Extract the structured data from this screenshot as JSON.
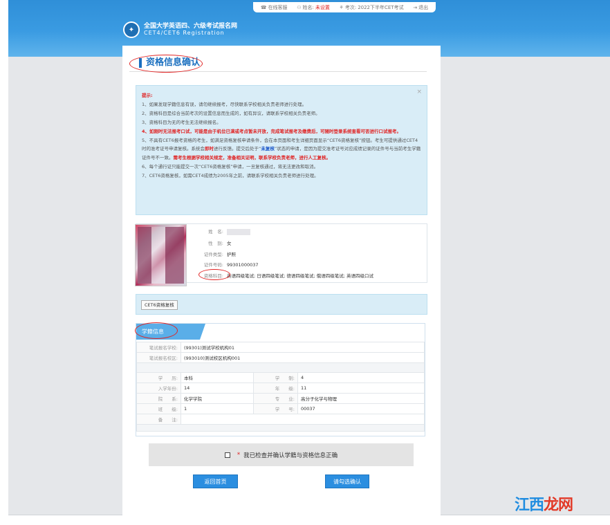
{
  "topbar": {
    "online_service": "在线客服",
    "name_label": "姓名:",
    "name_value": "未设置",
    "exam_label": "考次:",
    "exam_value": "2022下半年CET考试",
    "logout": "退出"
  },
  "logo": {
    "line1": "全国大学英语四、六级考试报名网",
    "line2": "CET4/CET6  Registration"
  },
  "page_title": "资格信息确认",
  "notice": {
    "heading": "提示:",
    "items": [
      "1、如果发现学籍信息有误，请勿继续报考，尽快联系学校相关负责老师进行处理。",
      "2、资格科目是综合当前考次的设置信息而生成的，如有异议，请联系学校相关负责老师。",
      "3、资格科目为无的考生无法继续报名。",
      "4、如刚时无法报考口试，可能是由于机位已满或考点暂未开放，完成笔试报考及缴费后，可随时登录系统查看可否进行口试报考。"
    ],
    "item5_a": "5、不具有CET6报考资格的考生，如满足资格复核申请条件，会在本页面和考生详细页面显示“CET6资格复核”按钮。考生可提供通过CET4时的准考证号申请复核。系统会",
    "item5_b": "即时",
    "item5_c": "进行反馈。提交后处于“",
    "item5_d": "未复核",
    "item5_e": "”状态的申请，是因为提交准考证号对应成绩记录的证件号与当前考生学籍证件号不一致。",
    "item5_f": "需考生根据学校相关规定，准备相关证明，联系学校负责老师，进行人工复核。",
    "item6": "6、每个通行证只能提交一次“CET6资格复核”申请，一旦复核通过，将无法更改和取消。",
    "item7": "7、CET6资格复核，如需CET4成绩为2005年之前，请联系学校相关负责老师进行处理。"
  },
  "personal": {
    "name_label": "姓　名:",
    "gender_label": "性　别:",
    "gender_value": "女",
    "id_type_label": "证件类型:",
    "id_type_value": "护照",
    "id_no_label": "证件号码:",
    "id_no_value": "99301000037",
    "subjects_label": "资格科目:",
    "subjects_value": "英语四级笔试; 日语四级笔试; 德语四级笔试; 俄语四级笔试; 英语四级口试"
  },
  "review_button": "CET6资格复核",
  "school": {
    "tab": "学籍信息",
    "rows": [
      {
        "k": "笔试报名学校:",
        "v": "(99301)测试学校机构01"
      },
      {
        "k": "笔试报名校区:",
        "v": "(993010)测试校区机构001"
      }
    ],
    "grid": [
      {
        "k1": "学　　历:",
        "v1": "本科",
        "k2": "学　　制:",
        "v2": "4"
      },
      {
        "k1": "入学年份:",
        "v1": "14",
        "k2": "年　　级:",
        "v2": "11"
      },
      {
        "k1": "院　　系:",
        "v1": "化学学院",
        "k2": "专　　业:",
        "v2": "高分子化学与物理"
      },
      {
        "k1": "班　　级:",
        "v1": "1",
        "k2": "学　　号:",
        "v2": "00037"
      }
    ],
    "remark_label": "备　　注:"
  },
  "confirm": {
    "star": "*",
    "text": "我已检查并确认学籍与资格信息正确"
  },
  "buttons": {
    "home": "返回首页",
    "confirm": "请勾选确认"
  },
  "watermark": {
    "part1": "江西",
    "part2": "龙网"
  }
}
